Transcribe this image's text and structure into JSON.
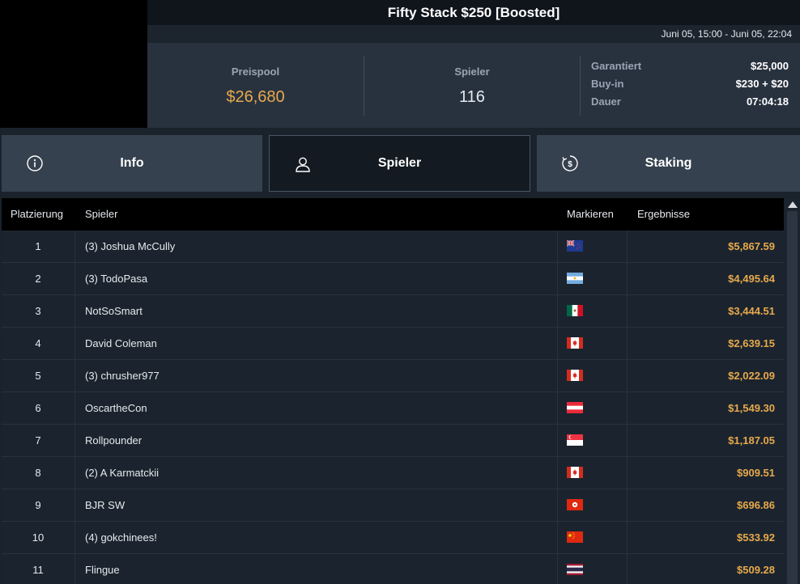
{
  "header": {
    "title": "Fifty Stack $250 [Boosted]",
    "date_range": "Juni 05, 15:00 - Juni 05, 22:04"
  },
  "stats": {
    "prize_pool_label": "Preispool",
    "prize_pool_value": "$26,680",
    "players_label": "Spieler",
    "players_value": "116",
    "guaranteed_label": "Garantiert",
    "guaranteed_value": "$25,000",
    "buyin_label": "Buy-in",
    "buyin_value": "$230 + $20",
    "duration_label": "Dauer",
    "duration_value": "07:04:18"
  },
  "tabs": [
    {
      "label": "Info",
      "icon": "info-icon"
    },
    {
      "label": "Spieler",
      "icon": "user-icon",
      "active": true
    },
    {
      "label": "Staking",
      "icon": "dollar-cycle-icon"
    }
  ],
  "table": {
    "columns": [
      "Platzierung",
      "Spieler",
      "Markieren",
      "Ergebnisse"
    ],
    "rows": [
      {
        "rank": "1",
        "name": "(3) Joshua McCully",
        "flag": "nz",
        "result": "$5,867.59"
      },
      {
        "rank": "2",
        "name": "(3) TodoPasa",
        "flag": "ar",
        "result": "$4,495.64"
      },
      {
        "rank": "3",
        "name": "NotSoSmart",
        "flag": "mx",
        "result": "$3,444.51"
      },
      {
        "rank": "4",
        "name": "David Coleman",
        "flag": "ca",
        "result": "$2,639.15"
      },
      {
        "rank": "5",
        "name": "(3) chrusher977",
        "flag": "ca",
        "result": "$2,022.09"
      },
      {
        "rank": "6",
        "name": "OscartheCon",
        "flag": "at",
        "result": "$1,549.30"
      },
      {
        "rank": "7",
        "name": "Rollpounder",
        "flag": "sg",
        "result": "$1,187.05"
      },
      {
        "rank": "8",
        "name": "(2) A Karmatckii",
        "flag": "ca",
        "result": "$909.51"
      },
      {
        "rank": "9",
        "name": "BJR SW",
        "flag": "hk",
        "result": "$696.86"
      },
      {
        "rank": "10",
        "name": "(4) gokchinees!",
        "flag": "cn",
        "result": "$533.92"
      },
      {
        "rank": "11",
        "name": "Flingue",
        "flag": "th",
        "result": "$509.28"
      }
    ]
  },
  "colors": {
    "accent_gold": "#e7a94c",
    "panel": "#28323f",
    "background": "#1a222c"
  }
}
